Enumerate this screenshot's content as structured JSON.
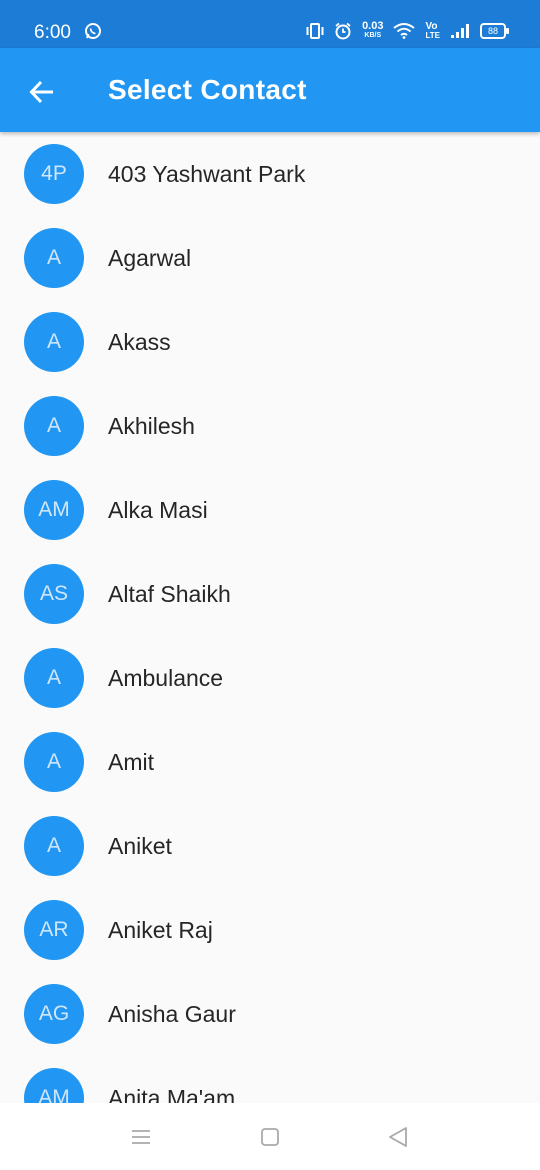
{
  "status_bar": {
    "time": "6:00",
    "net_speed_value": "0.03",
    "net_speed_unit": "KB/S",
    "volte_top": "Vo",
    "volte_bottom": "LTE",
    "battery": "88"
  },
  "app_bar": {
    "title": "Select Contact",
    "color": "#2196f3"
  },
  "contacts": [
    {
      "initials": "4P",
      "name": "403 Yashwant Park"
    },
    {
      "initials": "A",
      "name": "Agarwal"
    },
    {
      "initials": "A",
      "name": "Akass"
    },
    {
      "initials": "A",
      "name": "Akhilesh"
    },
    {
      "initials": "AM",
      "name": "Alka Masi"
    },
    {
      "initials": "AS",
      "name": "Altaf Shaikh"
    },
    {
      "initials": "A",
      "name": "Ambulance"
    },
    {
      "initials": "A",
      "name": "Amit"
    },
    {
      "initials": "A",
      "name": "Aniket"
    },
    {
      "initials": "AR",
      "name": "Aniket Raj"
    },
    {
      "initials": "AG",
      "name": "Anisha Gaur"
    },
    {
      "initials": "AM",
      "name": "Anita Ma'am"
    }
  ]
}
